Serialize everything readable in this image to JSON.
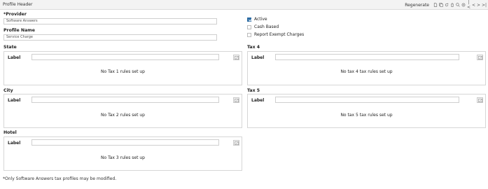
{
  "header": {
    "title": "Profile Header",
    "regenerate_label": "Regenerate",
    "icons": [
      "new-doc-icon",
      "copy-icon",
      "refresh-icon",
      "delete-icon",
      "search-icon",
      "settings-icon"
    ],
    "nav": [
      "|<",
      "<",
      ">",
      ">|"
    ]
  },
  "form": {
    "provider_label": "*Provider",
    "provider_value": "Software Answers",
    "profile_name_label": "Profile Name",
    "profile_name_value": "Service Charge",
    "active_label": "Active",
    "active_checked": true,
    "cash_based_label": "Cash Based",
    "cash_based_checked": false,
    "report_exempt_label": "Report Exempt Charges",
    "report_exempt_checked": false
  },
  "sections": {
    "state": {
      "title": "State",
      "label": "Label",
      "message": "No Tax 1 rules set up"
    },
    "tax4": {
      "title": "Tax 4",
      "label": "Label",
      "message": "No tax 4 tax rules set up"
    },
    "city": {
      "title": "City",
      "label": "Label",
      "message": "No Tax 2 rules set up"
    },
    "tax5": {
      "title": "Tax 5",
      "label": "Label",
      "message": "No tax 5 tax rules set up"
    },
    "hotel": {
      "title": "Hotel",
      "label": "Label",
      "message": "No Tax 3 rules set up"
    }
  },
  "footnote": "*Only Software Answers tax profiles may be modified."
}
